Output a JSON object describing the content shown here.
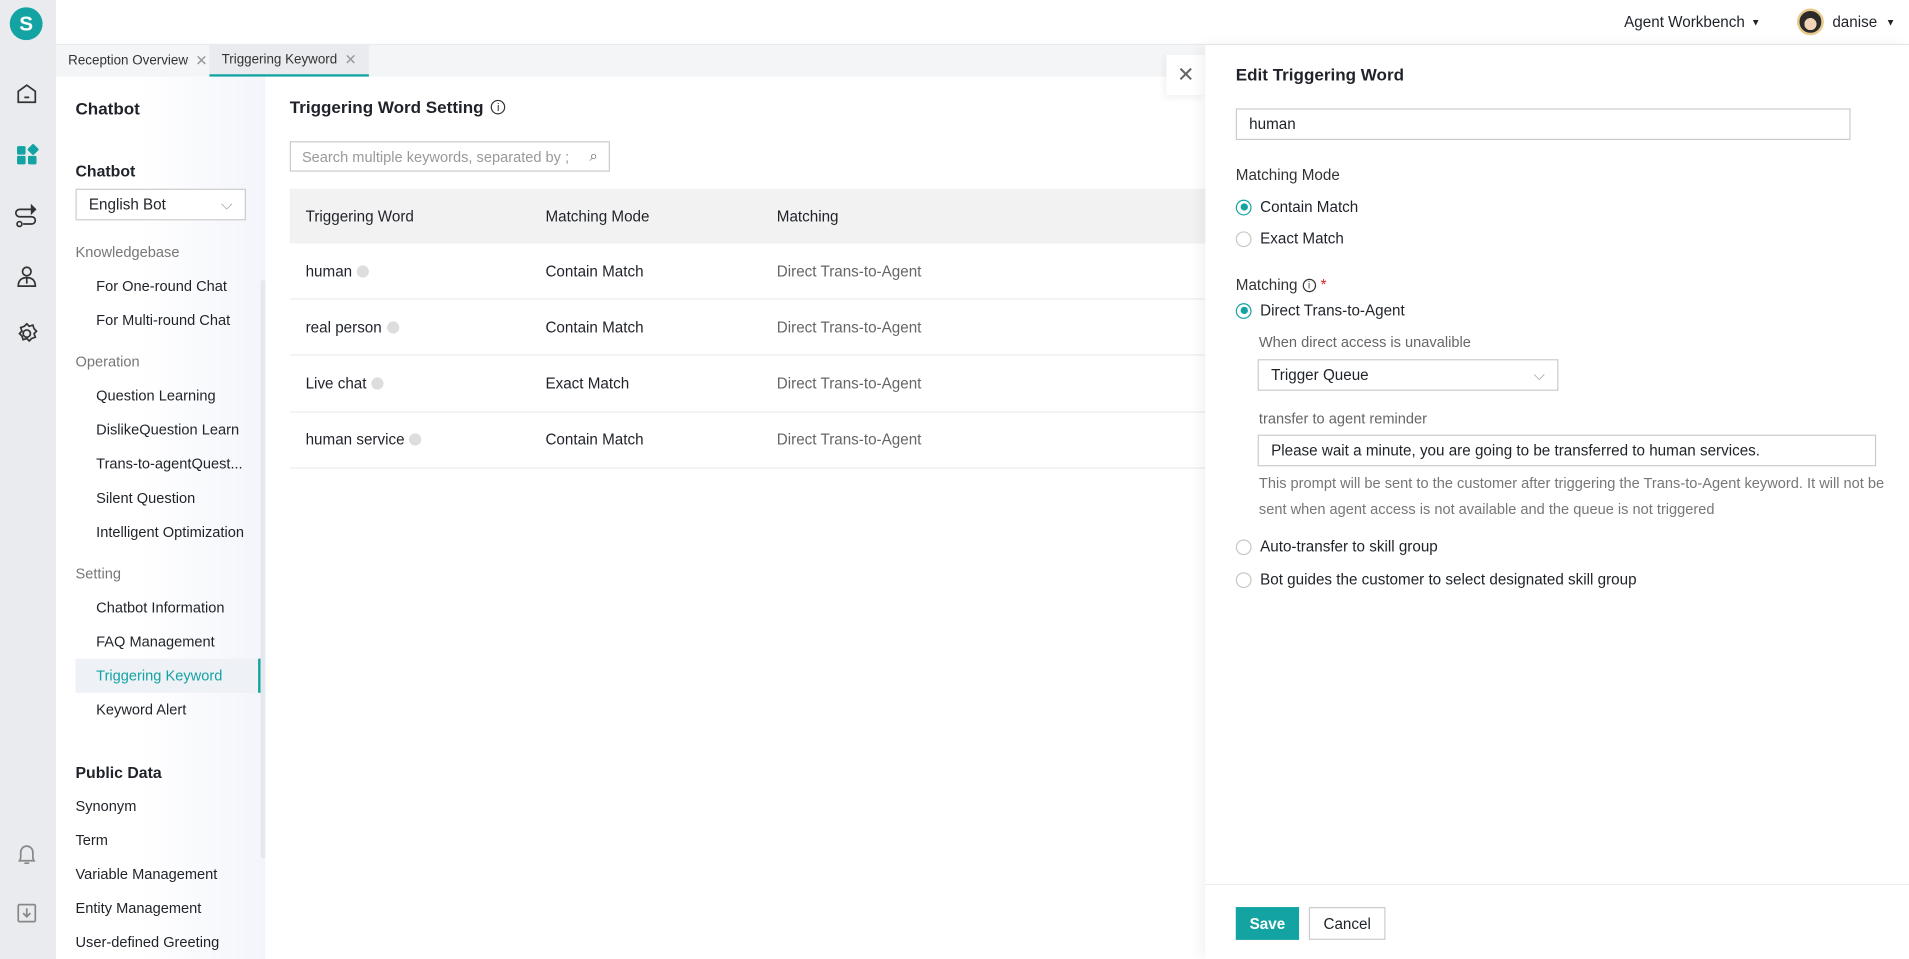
{
  "colors": {
    "accent": "#14a3a3",
    "required": "#e02020"
  },
  "app": {
    "logo_letter": "S"
  },
  "rail": {
    "icons": [
      "home-icon",
      "apps-icon",
      "flow-icon",
      "agent-icon",
      "gear-icon",
      "bell-icon",
      "download-icon"
    ]
  },
  "topbar": {
    "workbench": "Agent Workbench",
    "user": "danise"
  },
  "tabs": [
    {
      "label": "Reception Overview"
    },
    {
      "label": "Triggering Keyword"
    }
  ],
  "sidebar": {
    "title": "Chatbot",
    "chatbot_label": "Chatbot",
    "chatbot_select": "English Bot",
    "groups": [
      {
        "label": "Knowledgebase",
        "items": [
          "For One-round Chat",
          "For Multi-round Chat"
        ]
      },
      {
        "label": "Operation",
        "items": [
          "Question Learning",
          "DislikeQuestion Learn",
          "Trans-to-agentQuest...",
          "Silent Question",
          "Intelligent Optimization"
        ]
      },
      {
        "label": "Setting",
        "items": [
          "Chatbot Information",
          "FAQ Management",
          "Triggering Keyword",
          "Keyword Alert"
        ]
      }
    ],
    "public_title": "Public Data",
    "public_items": [
      "Synonym",
      "Term",
      "Variable Management",
      "Entity Management",
      "User-defined Greeting"
    ]
  },
  "main": {
    "title": "Triggering Word Setting",
    "search_placeholder": "Search multiple keywords, separated by ;",
    "columns": [
      "Triggering Word",
      "Matching Mode",
      "Matching"
    ],
    "rows": [
      [
        "human",
        "Contain Match",
        "Direct Trans-to-Agent"
      ],
      [
        "real person",
        "Contain Match",
        "Direct Trans-to-Agent"
      ],
      [
        "Live chat",
        "Exact Match",
        "Direct Trans-to-Agent"
      ],
      [
        "human service",
        "Contain Match",
        "Direct Trans-to-Agent"
      ]
    ]
  },
  "drawer": {
    "title": "Edit Triggering Word",
    "word_value": "human",
    "matching_mode_label": "Matching Mode",
    "modes": [
      "Contain Match",
      "Exact Match"
    ],
    "matching_label": "Matching",
    "required_mark": "*",
    "options": [
      "Direct Trans-to-Agent",
      "Auto-transfer to skill group",
      "Bot guides the customer to select designated skill group"
    ],
    "unavailable_label": "When direct access is unavalible",
    "unavailable_select": "Trigger Queue",
    "reminder_label": "transfer to agent reminder",
    "reminder_value": "Please wait a minute, you are going to be transferred to human services.",
    "hint": "This prompt will be sent to the customer after triggering the Trans-to-Agent keyword. It will not be sent when agent access is not available and the queue is not triggered",
    "save": "Save",
    "cancel": "Cancel"
  }
}
